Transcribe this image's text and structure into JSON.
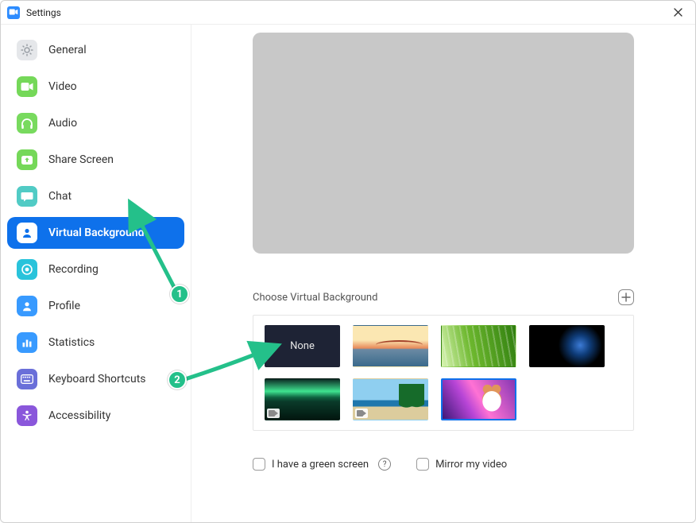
{
  "window": {
    "title": "Settings"
  },
  "sidebar": {
    "items": [
      {
        "label": "General",
        "icon": "gear-icon"
      },
      {
        "label": "Video",
        "icon": "video-icon"
      },
      {
        "label": "Audio",
        "icon": "headphones-icon"
      },
      {
        "label": "Share Screen",
        "icon": "share-screen-icon"
      },
      {
        "label": "Chat",
        "icon": "chat-icon"
      },
      {
        "label": "Virtual Background",
        "icon": "person-icon",
        "active": true
      },
      {
        "label": "Recording",
        "icon": "record-icon"
      },
      {
        "label": "Profile",
        "icon": "profile-icon"
      },
      {
        "label": "Statistics",
        "icon": "bars-icon"
      },
      {
        "label": "Keyboard Shortcuts",
        "icon": "keyboard-icon"
      },
      {
        "label": "Accessibility",
        "icon": "accessibility-icon"
      }
    ]
  },
  "content": {
    "choose_label": "Choose Virtual Background",
    "thumbnails": {
      "none_label": "None",
      "items": [
        {
          "kind": "none"
        },
        {
          "kind": "bridge"
        },
        {
          "kind": "grass"
        },
        {
          "kind": "earth"
        },
        {
          "kind": "aurora",
          "is_video": true
        },
        {
          "kind": "beach",
          "is_video": true
        },
        {
          "kind": "tiger",
          "selected": true
        }
      ]
    },
    "green_screen_label": "I have a green screen",
    "mirror_label": "Mirror my video"
  },
  "annotations": {
    "steps": [
      "1",
      "2"
    ]
  }
}
